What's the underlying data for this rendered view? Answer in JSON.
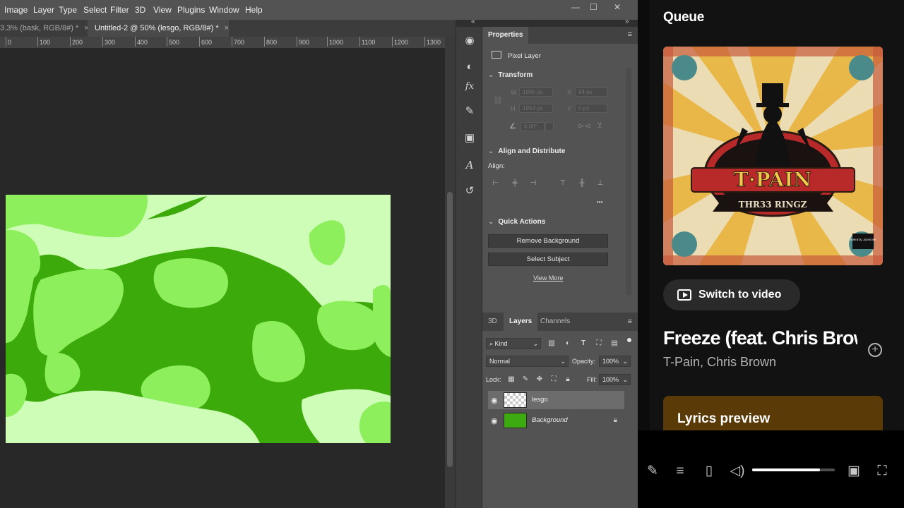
{
  "photoshop": {
    "menu": [
      "Image",
      "Layer",
      "Type",
      "Select",
      "Filter",
      "3D",
      "View",
      "Plugins",
      "Window",
      "Help"
    ],
    "window_controls": [
      "—",
      "☐",
      "✕"
    ],
    "doc_tabs": [
      {
        "label": "3.3% (bask, RGB/8#) *",
        "close": "×",
        "active": false
      },
      {
        "label": "Untitled-2 @ 50% (lesgo, RGB/8#) *",
        "close": "×",
        "active": true
      }
    ],
    "ruler_ticks": [
      "0",
      "100",
      "200",
      "300",
      "400",
      "500",
      "600",
      "700",
      "800",
      "900",
      "1000",
      "1100",
      "1200",
      "1300"
    ],
    "collapse_icons": {
      "left": "«",
      "right": "»"
    },
    "properties": {
      "tab": "Properties",
      "menu_icon": "≡",
      "pixel_layer": "Pixel Layer",
      "transform": {
        "title": "Transform",
        "w_label": "W",
        "w_value": "1905 px",
        "x_label": "X",
        "x_value": "94 px",
        "h_label": "H",
        "h_value": "1954 px",
        "y_label": "Y",
        "y_value": "0 px",
        "angle_value": "0.00°"
      },
      "align": {
        "title": "Align and Distribute",
        "label": "Align:",
        "more": "•••"
      },
      "quick_actions": {
        "title": "Quick Actions",
        "remove_bg": "Remove Background",
        "select_subject": "Select Subject",
        "view_more": "View More"
      }
    },
    "layers_panel": {
      "tabs": [
        "3D",
        "Layers",
        "Channels"
      ],
      "active_tab": "Layers",
      "menu_icon": "≡",
      "kind": "Kind",
      "blend_mode": "Normal",
      "opacity_label": "Opacity:",
      "opacity_value": "100%",
      "lock_label": "Lock:",
      "fill_label": "Fill:",
      "fill_value": "100%",
      "layers": [
        {
          "name": "lesgo",
          "selected": true,
          "thumb": "transparent"
        },
        {
          "name": "Background",
          "selected": false,
          "thumb": "green"
        }
      ]
    }
  },
  "music": {
    "queue_title": "Queue",
    "cover_text": {
      "artist": "T·PAIN",
      "album": "THR33 RINGZ",
      "advisory": "PARENTAL ADVISORY"
    },
    "switch_video": "Switch to video",
    "song_title": "Freeze (feat. Chris Brown)",
    "artist": "T-Pain, Chris Brown",
    "lyrics_title": "Lyrics preview",
    "volume_level": 0.82
  },
  "colors": {
    "ps_panel": "#535353",
    "ps_bg": "#282828",
    "music_bg": "#121212",
    "lyrics_bg": "#5a3a07",
    "art_dark_green": "#3daa0c",
    "art_mid_green": "#8def5b",
    "art_light_green": "#cdfdb6"
  }
}
